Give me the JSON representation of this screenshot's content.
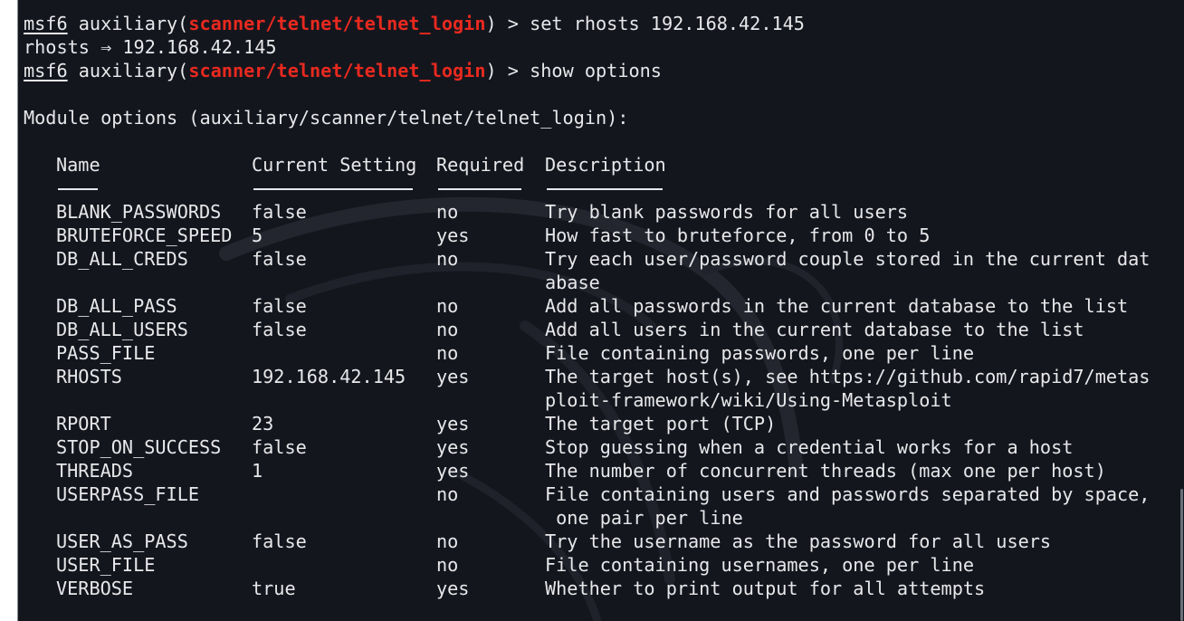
{
  "prompt": {
    "msf": "msf6",
    "prefix": " auxiliary(",
    "module": "scanner/telnet/telnet_login",
    "suffix": ") > "
  },
  "history": {
    "cmd1": "set rhosts 192.168.42.145",
    "output1": "rhosts ⇒ 192.168.42.145",
    "cmd2": "show options"
  },
  "module_options": {
    "heading": "Module options (auxiliary/scanner/telnet/telnet_login):",
    "columns": [
      "Name",
      "Current Setting",
      "Required",
      "Description"
    ],
    "rows": [
      {
        "name": "BLANK_PASSWORDS",
        "setting": "false",
        "required": "no",
        "desc": [
          "Try blank passwords for all users"
        ]
      },
      {
        "name": "BRUTEFORCE_SPEED",
        "setting": "5",
        "required": "yes",
        "desc": [
          "How fast to bruteforce, from 0 to 5"
        ]
      },
      {
        "name": "DB_ALL_CREDS",
        "setting": "false",
        "required": "no",
        "desc": [
          "Try each user/password couple stored in the current dat",
          "abase"
        ]
      },
      {
        "name": "DB_ALL_PASS",
        "setting": "false",
        "required": "no",
        "desc": [
          "Add all passwords in the current database to the list"
        ]
      },
      {
        "name": "DB_ALL_USERS",
        "setting": "false",
        "required": "no",
        "desc": [
          "Add all users in the current database to the list"
        ]
      },
      {
        "name": "PASS_FILE",
        "setting": "",
        "required": "no",
        "desc": [
          "File containing passwords, one per line"
        ]
      },
      {
        "name": "RHOSTS",
        "setting": "192.168.42.145",
        "required": "yes",
        "desc": [
          "The target host(s), see https://github.com/rapid7/metas",
          "ploit-framework/wiki/Using-Metasploit"
        ]
      },
      {
        "name": "RPORT",
        "setting": "23",
        "required": "yes",
        "desc": [
          "The target port (TCP)"
        ]
      },
      {
        "name": "STOP_ON_SUCCESS",
        "setting": "false",
        "required": "yes",
        "desc": [
          "Stop guessing when a credential works for a host"
        ]
      },
      {
        "name": "THREADS",
        "setting": "1",
        "required": "yes",
        "desc": [
          "The number of concurrent threads (max one per host)"
        ]
      },
      {
        "name": "USERPASS_FILE",
        "setting": "",
        "required": "no",
        "desc": [
          "File containing users and passwords separated by space,",
          " one pair per line"
        ]
      },
      {
        "name": "USER_AS_PASS",
        "setting": "false",
        "required": "no",
        "desc": [
          "Try the username as the password for all users"
        ]
      },
      {
        "name": "USER_FILE",
        "setting": "",
        "required": "no",
        "desc": [
          "File containing usernames, one per line"
        ]
      },
      {
        "name": "VERBOSE",
        "setting": "true",
        "required": "yes",
        "desc": [
          "Whether to print output for all attempts"
        ]
      }
    ]
  },
  "colors": {
    "background": "#14161e",
    "text": "#e8e8ea",
    "module": "#e8291f"
  },
  "icons": {
    "watermark": "kali-dragon-watermark"
  }
}
